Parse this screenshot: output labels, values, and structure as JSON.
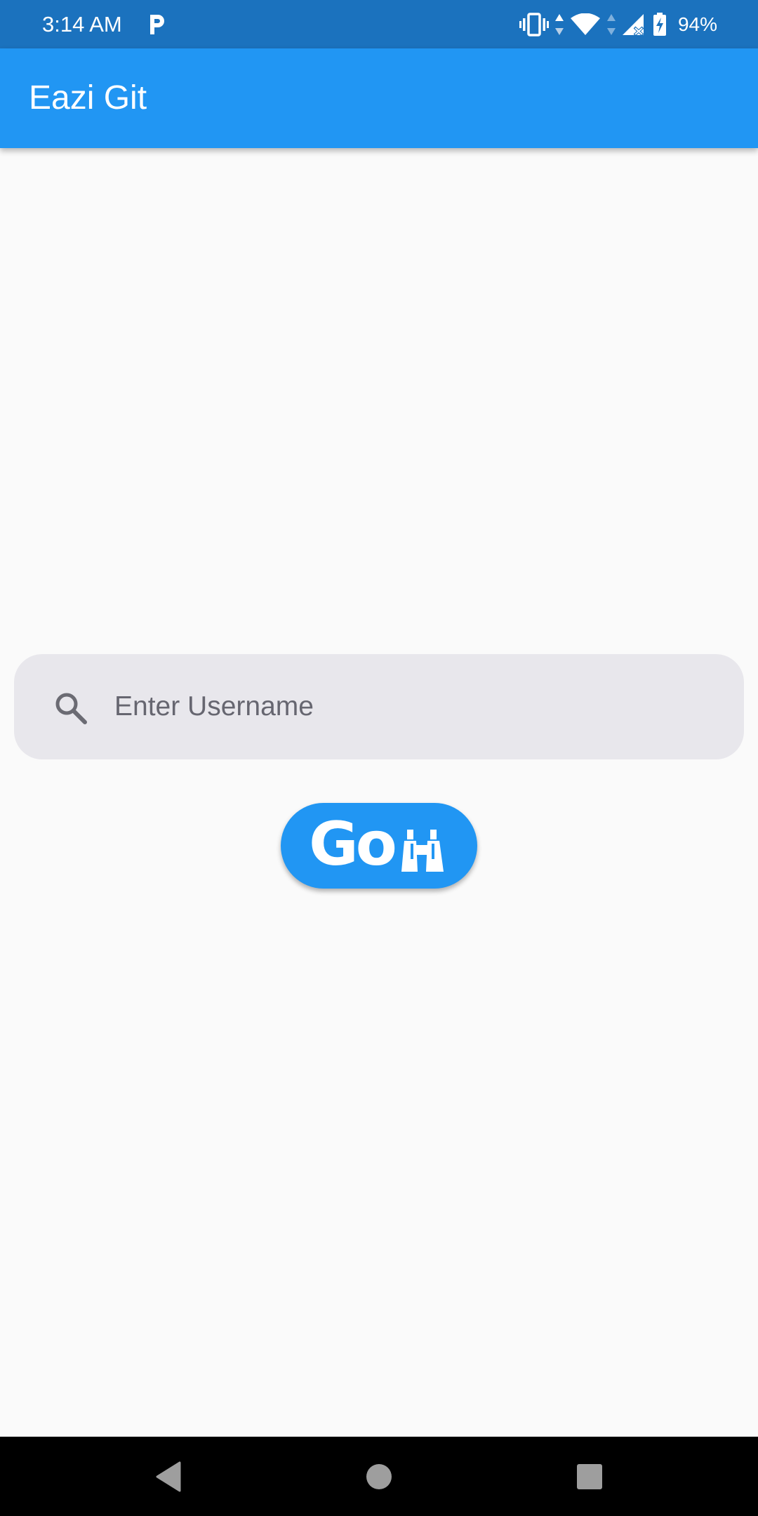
{
  "status_bar": {
    "time": "3:14 AM",
    "battery": "94%"
  },
  "app_bar": {
    "title": "Eazi Git"
  },
  "search": {
    "placeholder": "Enter Username",
    "value": ""
  },
  "go_button": {
    "label": "Go"
  },
  "colors": {
    "status_bar": "#1b72be",
    "primary": "#2196f3",
    "background": "#fafafa",
    "search_field": "#e8e7ec",
    "nav_bar": "#000000"
  },
  "icons": {
    "status_app": "parking-icon",
    "vibrate": "vibrate-icon",
    "wifi": "wifi-icon",
    "signal": "cellular-signal-icon",
    "battery": "battery-charging-icon",
    "search": "search-icon",
    "go": "binoculars-icon",
    "nav_back": "back-triangle-icon",
    "nav_home": "home-circle-icon",
    "nav_recents": "recents-square-icon"
  }
}
